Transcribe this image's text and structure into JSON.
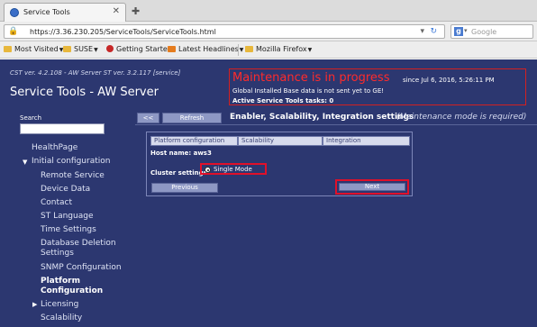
{
  "browser": {
    "tab_title": "Service Tools",
    "url": "https://3.36.230.205/ServiceTools/ServiceTools.html",
    "search_placeholder": "Google",
    "bookmarks": [
      {
        "label": "Most Visited",
        "icon": "folder-icon"
      },
      {
        "label": "SUSE",
        "icon": "folder-icon"
      },
      {
        "label": "Getting Started",
        "icon": "firefox-icon"
      },
      {
        "label": "Latest Headlines",
        "icon": "rss-feed-icon"
      },
      {
        "label": "Mozilla Firefox",
        "icon": "folder-icon"
      }
    ]
  },
  "header": {
    "version": "CST ver. 4.2.108 - AW Server ST ver. 3.2.117 [service]",
    "app_title": "Service Tools - AW Server"
  },
  "maintenance": {
    "title": "Maintenance is in progress",
    "since": "since Jul 6, 2016, 5:26:11 PM",
    "message": "Global Installed Base data is not sent yet to GE!",
    "active_tasks": "Active Service Tools tasks: 0"
  },
  "sidebar": {
    "search_label": "Search",
    "items": [
      {
        "label": "HealthPage"
      },
      {
        "label": "Initial configuration"
      },
      {
        "label": "Remote Service"
      },
      {
        "label": "Device Data"
      },
      {
        "label": "Contact"
      },
      {
        "label": "ST Language"
      },
      {
        "label": "Time Settings"
      },
      {
        "label": "Database Deletion"
      },
      {
        "label": "Settings"
      },
      {
        "label": "SNMP Configuration"
      },
      {
        "label": "Platform"
      },
      {
        "label": "Configuration"
      },
      {
        "label": "Licensing"
      },
      {
        "label": "Scalability"
      }
    ]
  },
  "main": {
    "collapse_label": "<<",
    "refresh_label": "Refresh",
    "section_title": "Enabler, Scalability, Integration settings",
    "section_note": "(Maintenance mode is required)",
    "tabs": [
      "Platform configuration",
      "Scalability",
      "Integration"
    ],
    "host_name": "Host name: aws3",
    "cluster_settings_label": "Cluster settings",
    "single_mode_label": "Single Mode",
    "previous_label": "Previous",
    "next_label": "Next"
  },
  "colors": {
    "page_bg": "#2c3770",
    "maintenance_red": "#ff2b2b",
    "highlight_red": "#e0102a"
  }
}
